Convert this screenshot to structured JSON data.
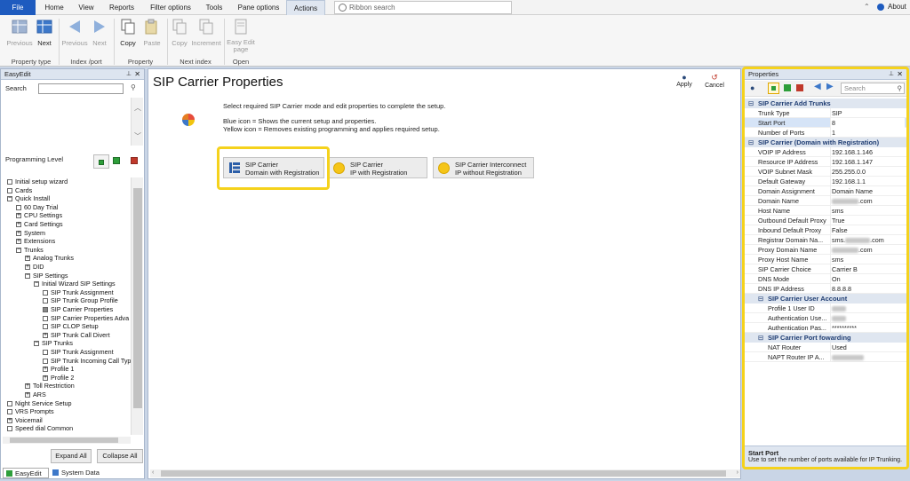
{
  "menu": {
    "file": "File",
    "home": "Home",
    "view": "View",
    "reports": "Reports",
    "filter": "Filter options",
    "tools": "Tools",
    "pane": "Pane options",
    "actions": "Actions",
    "search_placeholder": "Ribbon search",
    "about": "About"
  },
  "ribbon": {
    "previous": "Previous",
    "next": "Next",
    "previous2": "Previous",
    "next2": "Next",
    "copy": "Copy",
    "paste": "Paste",
    "copy2": "Copy",
    "increment": "Increment",
    "easy_edit_page": "Easy Edit page",
    "groups": {
      "property_type": "Property type",
      "index_port": "Index /port",
      "property": "Property",
      "next_index": "Next index",
      "open": "Open"
    }
  },
  "left": {
    "title": "EasyEdit",
    "search_label": "Search",
    "prog_level": "Programming Level",
    "tree": [
      {
        "l": "Initial setup wizard",
        "d": 0,
        "b": "none"
      },
      {
        "l": "Cards",
        "d": 0,
        "b": "none"
      },
      {
        "l": "Quick Install",
        "d": 0,
        "b": "col"
      },
      {
        "l": "60 Day Trial",
        "d": 1,
        "b": "none"
      },
      {
        "l": "CPU Settings",
        "d": 1,
        "b": "exp"
      },
      {
        "l": "Card Settings",
        "d": 1,
        "b": "exp"
      },
      {
        "l": "System",
        "d": 1,
        "b": "exp"
      },
      {
        "l": "Extensions",
        "d": 1,
        "b": "exp"
      },
      {
        "l": "Trunks",
        "d": 1,
        "b": "col"
      },
      {
        "l": "Analog Trunks",
        "d": 2,
        "b": "exp"
      },
      {
        "l": "DID",
        "d": 2,
        "b": "exp"
      },
      {
        "l": "SIP Settings",
        "d": 2,
        "b": "col"
      },
      {
        "l": "Initial Wizard SIP Settings",
        "d": 3,
        "b": "col"
      },
      {
        "l": "SIP Trunk Assignment",
        "d": 4,
        "b": "none"
      },
      {
        "l": "SIP Trunk Group Profile",
        "d": 4,
        "b": "none"
      },
      {
        "l": "SIP Carrier Properties",
        "d": 4,
        "b": "sel"
      },
      {
        "l": "SIP Carrier Properties Adva",
        "d": 4,
        "b": "none"
      },
      {
        "l": "SIP CLOP Setup",
        "d": 4,
        "b": "none"
      },
      {
        "l": "SIP Trunk Call Divert",
        "d": 4,
        "b": "exp"
      },
      {
        "l": "SIP Trunks",
        "d": 3,
        "b": "col"
      },
      {
        "l": "SIP Trunk Assignment",
        "d": 4,
        "b": "none"
      },
      {
        "l": "SIP Trunk Incoming Call Typ",
        "d": 4,
        "b": "none"
      },
      {
        "l": "Profile 1",
        "d": 4,
        "b": "exp"
      },
      {
        "l": "Profile 2",
        "d": 4,
        "b": "exp"
      },
      {
        "l": "Toll Restriction",
        "d": 2,
        "b": "exp"
      },
      {
        "l": "ARS",
        "d": 2,
        "b": "exp"
      },
      {
        "l": "Night Service Setup",
        "d": 0,
        "b": "none"
      },
      {
        "l": "VRS Prompts",
        "d": 0,
        "b": "none"
      },
      {
        "l": "Voicemail",
        "d": 0,
        "b": "exp"
      },
      {
        "l": "Speed dial Common",
        "d": 0,
        "b": "none"
      }
    ],
    "expand_all": "Expand All",
    "collapse_all": "Collapse All",
    "tab_easyedit": "EasyEdit",
    "tab_system": "System Data"
  },
  "center": {
    "title": "SIP Carrier Properties",
    "apply": "Apply",
    "cancel": "Cancel",
    "intro": "Select required SIP Carrier mode and edit properties to complete the setup.",
    "blue": "Blue icon  = Shows the current setup and properties.",
    "yellow": "Yellow icon = Removes existing programming and applies required setup.",
    "opt1_l1": "SIP Carrier",
    "opt1_l2": "Domain with Registration",
    "opt2_l1": "SIP Carrier",
    "opt2_l2": "IP with Registration",
    "opt3_l1": "SIP Carrier Interconnect",
    "opt3_l2": "IP without Registration"
  },
  "props": {
    "title": "Properties",
    "search_placeholder": "Search",
    "cat1": "SIP Carrier Add Trunks",
    "trunk_type_k": "Trunk Type",
    "trunk_type_v": "SIP",
    "start_port_k": "Start Port",
    "start_port_v": "8",
    "num_ports_k": "Number of Ports",
    "num_ports_v": "1",
    "cat2": "SIP Carrier (Domain with Registration)",
    "voip_ip_k": "VOIP IP Address",
    "voip_ip_v": "192.168.1.146",
    "res_ip_k": "Resource IP Address",
    "res_ip_v": "192.168.1.147",
    "subnet_k": "VOIP Subnet Mask",
    "subnet_v": "255.255.0.0",
    "gw_k": "Default Gateway",
    "gw_v": "192.168.1.1",
    "dom_assign_k": "Domain Assignment",
    "dom_assign_v": "Domain Name",
    "dom_name_k": "Domain Name",
    "dom_name_v": ".com",
    "host_name_k": "Host Name",
    "host_name_v": "sms",
    "out_proxy_k": "Outbound Default Proxy",
    "out_proxy_v": "True",
    "in_proxy_k": "Inbound Default Proxy",
    "in_proxy_v": "False",
    "reg_dom_k": "Registrar Domain Na...",
    "reg_dom_v1": "sms.",
    "reg_dom_v2": ".com",
    "proxy_dom_k": "Proxy Domain Name",
    "proxy_dom_v": ".com",
    "proxy_host_k": "Proxy Host Name",
    "proxy_host_v": "sms",
    "choice_k": "SIP Carrier Choice",
    "choice_v": "Carrier B",
    "dns_mode_k": "DNS Mode",
    "dns_mode_v": "On",
    "dns_ip_k": "DNS IP Address",
    "dns_ip_v": "8.8.8.8",
    "cat3": "SIP Carrier User Account",
    "p1_user_k": "Profile 1 User ID",
    "auth_user_k": "Authentication Use...",
    "auth_pass_k": "Authentication Pas...",
    "auth_pass_v": "**********",
    "cat4": "SIP Carrier Port fowarding",
    "nat_k": "NAT Router",
    "nat_v": "Used",
    "napt_k": "NAPT Router IP A...",
    "footer_title": "Start Port",
    "footer_desc": "Use to set the number of ports available for IP Trunking."
  },
  "colors": {
    "highlight": "#f5d21c",
    "file_tab": "#1e5bbf",
    "accent_blue": "#2b6fd6"
  }
}
